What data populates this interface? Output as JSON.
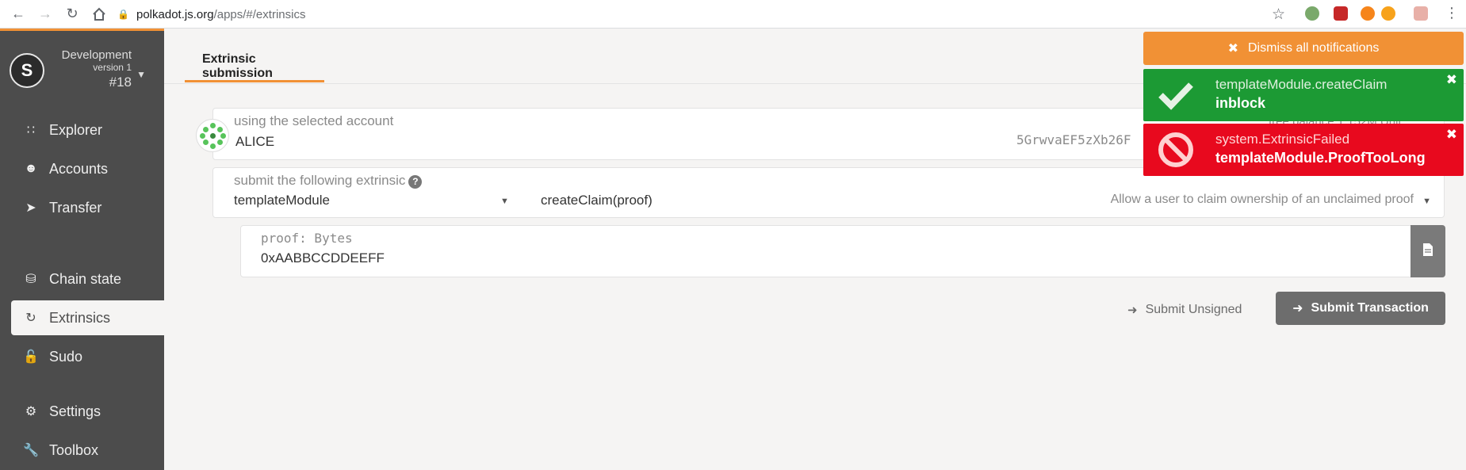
{
  "browser": {
    "url_host": "polkadot.js.org",
    "url_path": "/apps/#/extrinsics",
    "ext_badge": "2"
  },
  "chain": {
    "name": "Development",
    "version": "version 1",
    "block": "#18"
  },
  "sidebar": {
    "items": [
      {
        "label": "Explorer",
        "icon": "explorer-icon"
      },
      {
        "label": "Accounts",
        "icon": "users-icon"
      },
      {
        "label": "Transfer",
        "icon": "send-icon"
      },
      {
        "label": "Chain state",
        "icon": "database-icon"
      },
      {
        "label": "Extrinsics",
        "icon": "sync-icon"
      },
      {
        "label": "Sudo",
        "icon": "unlock-icon"
      },
      {
        "label": "Settings",
        "icon": "cogs-icon"
      },
      {
        "label": "Toolbox",
        "icon": "wrench-icon"
      }
    ]
  },
  "tabs": {
    "active": "Extrinsic submission"
  },
  "account": {
    "label": "using the selected account",
    "name": "ALICE",
    "address": "5GrwvaEF5zXb26F",
    "balance_partial": "free balance 1.152M Unit"
  },
  "extrinsic": {
    "label": "submit the following extrinsic",
    "module": "templateModule",
    "call": "createClaim(proof)",
    "description": "Allow a user to claim ownership of an unclaimed proof"
  },
  "param": {
    "label": "proof: Bytes",
    "value": "0xAABBCCDDEEFF"
  },
  "actions": {
    "unsigned": "Submit Unsigned",
    "submit": "Submit Transaction"
  },
  "notifications": {
    "dismiss_all": "Dismiss all notifications",
    "items": [
      {
        "title": "templateModule.createClaim",
        "status": "inblock",
        "kind": "success"
      },
      {
        "title": "system.ExtrinsicFailed",
        "status": "templateModule.ProofTooLong",
        "kind": "error"
      }
    ]
  },
  "colors": {
    "accent": "#f19135",
    "sidebar": "#4c4c4c",
    "success": "#1c9a34",
    "error": "#e8091e"
  }
}
